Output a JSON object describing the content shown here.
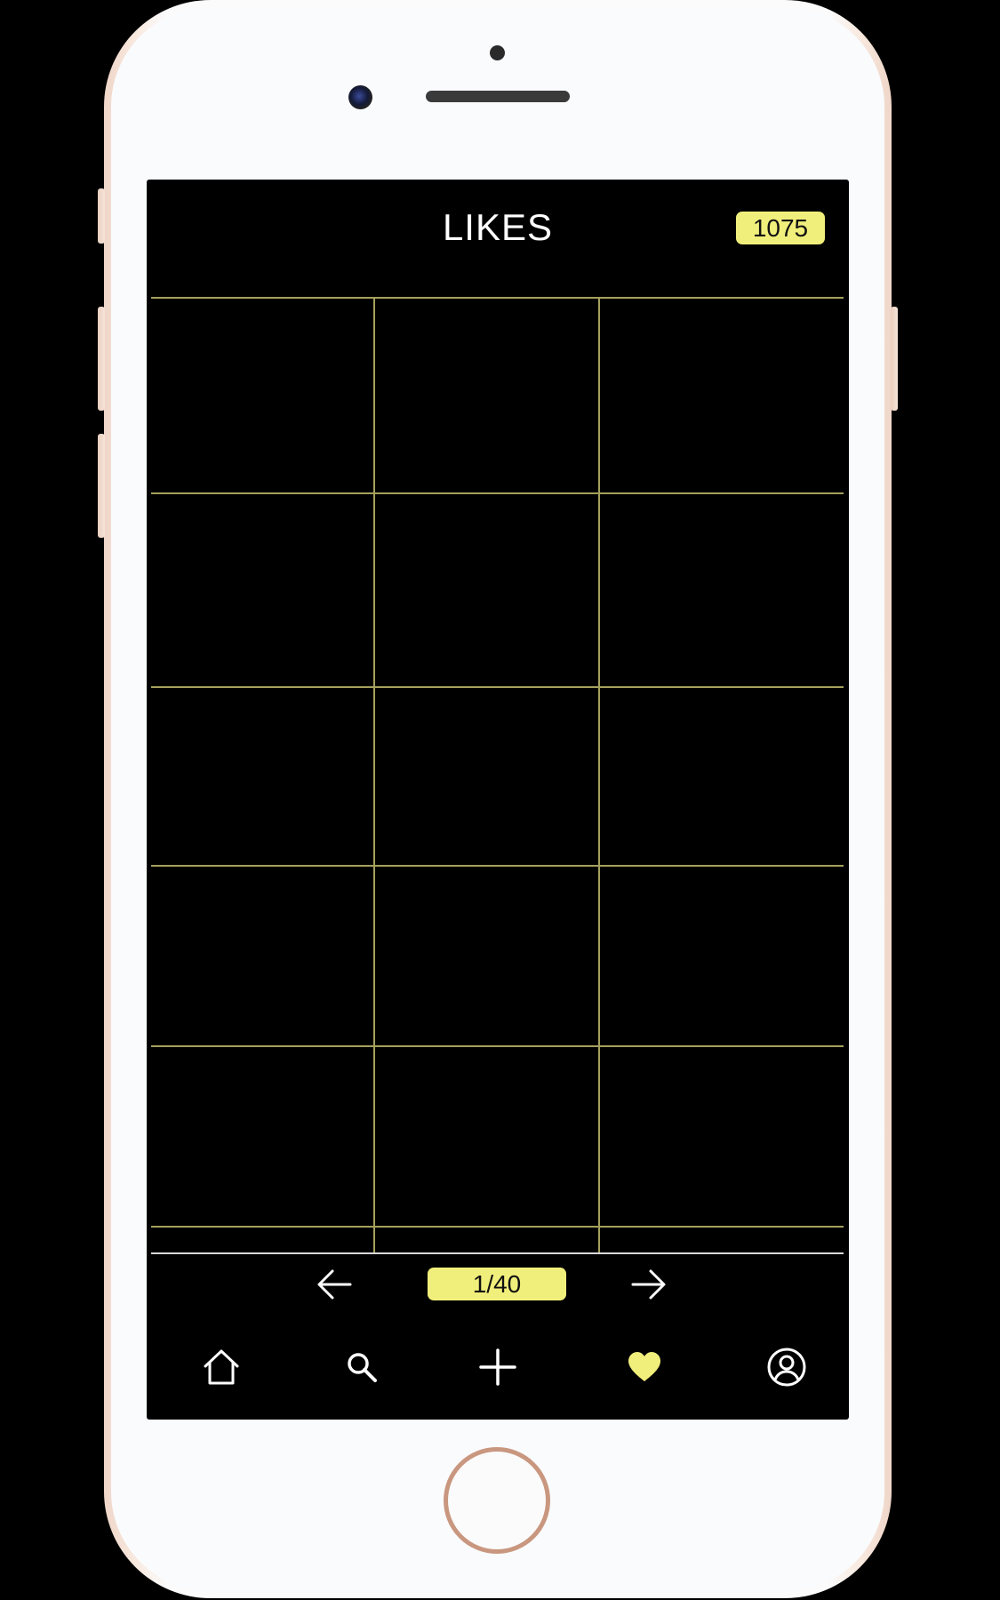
{
  "header": {
    "title": "LIKES",
    "count": "1075"
  },
  "pagination": {
    "indicator": "1/40",
    "prev_icon": "arrow-left-icon",
    "next_icon": "arrow-right-icon"
  },
  "grid": {
    "rows": 5,
    "columns": 3,
    "cells": []
  },
  "nav": {
    "items": [
      {
        "icon": "home-icon",
        "active": false
      },
      {
        "icon": "search-icon",
        "active": false
      },
      {
        "icon": "plus-icon",
        "active": false
      },
      {
        "icon": "heart-icon",
        "active": true
      },
      {
        "icon": "profile-icon",
        "active": false
      }
    ]
  },
  "colors": {
    "accent": "#f1ef7b",
    "background": "#000000",
    "grid_line": "#a5a05c",
    "text": "#ffffff"
  }
}
